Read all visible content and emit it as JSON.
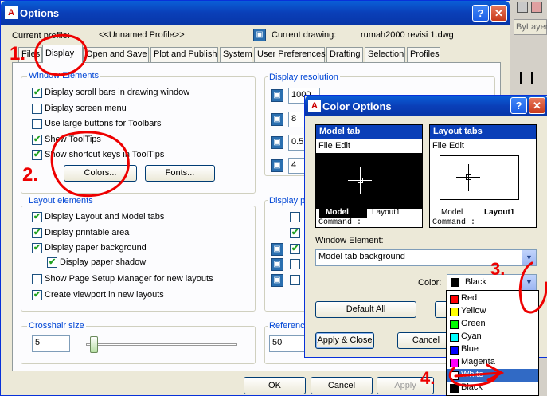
{
  "options": {
    "title": "Options",
    "current_profile_label": "Current profile:",
    "current_profile_value": "<<Unnamed Profile>>",
    "current_drawing_label": "Current drawing:",
    "current_drawing_value": "rumah2000 revisi 1.dwg"
  },
  "tabs": [
    {
      "label": "Files"
    },
    {
      "label": "Display"
    },
    {
      "label": "Open and Save"
    },
    {
      "label": "Plot and Publish"
    },
    {
      "label": "System"
    },
    {
      "label": "User Preferences"
    },
    {
      "label": "Drafting"
    },
    {
      "label": "Selection"
    },
    {
      "label": "Profiles"
    }
  ],
  "window_elements": {
    "title": "Window Elements",
    "items": [
      {
        "label": "Display scroll bars in drawing window",
        "checked": true
      },
      {
        "label": "Display screen menu",
        "checked": false
      },
      {
        "label": "Use large buttons for Toolbars",
        "checked": false
      },
      {
        "label": "Show ToolTips",
        "checked": true
      },
      {
        "label": "Show shortcut keys in ToolTips",
        "checked": true
      }
    ],
    "colors_button": "Colors...",
    "fonts_button": "Fonts..."
  },
  "layout_elements": {
    "title": "Layout elements",
    "items": [
      {
        "label": "Display Layout and Model tabs",
        "checked": true
      },
      {
        "label": "Display printable area",
        "checked": true
      },
      {
        "label": "Display paper background",
        "checked": true
      },
      {
        "label": "Display paper shadow",
        "checked": true
      },
      {
        "label": "Show Page Setup Manager for new layouts",
        "checked": false
      },
      {
        "label": "Create viewport in new layouts",
        "checked": true
      }
    ]
  },
  "display_resolution": {
    "title": "Display resolution",
    "values": [
      "1000",
      "8",
      "0.5",
      "4"
    ]
  },
  "display_performance": {
    "title": "Display pe"
  },
  "crosshair": {
    "title": "Crosshair size",
    "value": "5",
    "slider_fraction": 0.05
  },
  "reference": {
    "title": "Reference",
    "value": "50"
  },
  "footer": {
    "ok": "OK",
    "cancel": "Cancel",
    "apply": "Apply"
  },
  "color_options": {
    "title": "Color Options",
    "model_tab_title": "Model tab",
    "layout_tabs_title": "Layout tabs",
    "menu_file": "File",
    "menu_edit": "Edit",
    "tab_model": "Model",
    "tab_layout1": "Layout1",
    "command_text": "Command :",
    "window_element_label": "Window Element:",
    "window_element_value": "Model tab background",
    "color_label": "Color:",
    "color_value": "Black",
    "default_all": "Default All",
    "apply_close": "Apply & Close",
    "cancel": "Cancel"
  },
  "color_list": [
    {
      "name": "Red",
      "hex": "#ff0000"
    },
    {
      "name": "Yellow",
      "hex": "#ffff00"
    },
    {
      "name": "Green",
      "hex": "#00ff00"
    },
    {
      "name": "Cyan",
      "hex": "#00ffff"
    },
    {
      "name": "Blue",
      "hex": "#0000ff"
    },
    {
      "name": "Magenta",
      "hex": "#ff00ff"
    },
    {
      "name": "White",
      "hex": "#ffffff",
      "selected": true
    },
    {
      "name": "Black",
      "hex": "#000000"
    }
  ],
  "annotations": {
    "step1": "1.",
    "step2": "2.",
    "step3": "3.",
    "step4": "4."
  },
  "background_app": {
    "bylayer": "ByLayer"
  }
}
